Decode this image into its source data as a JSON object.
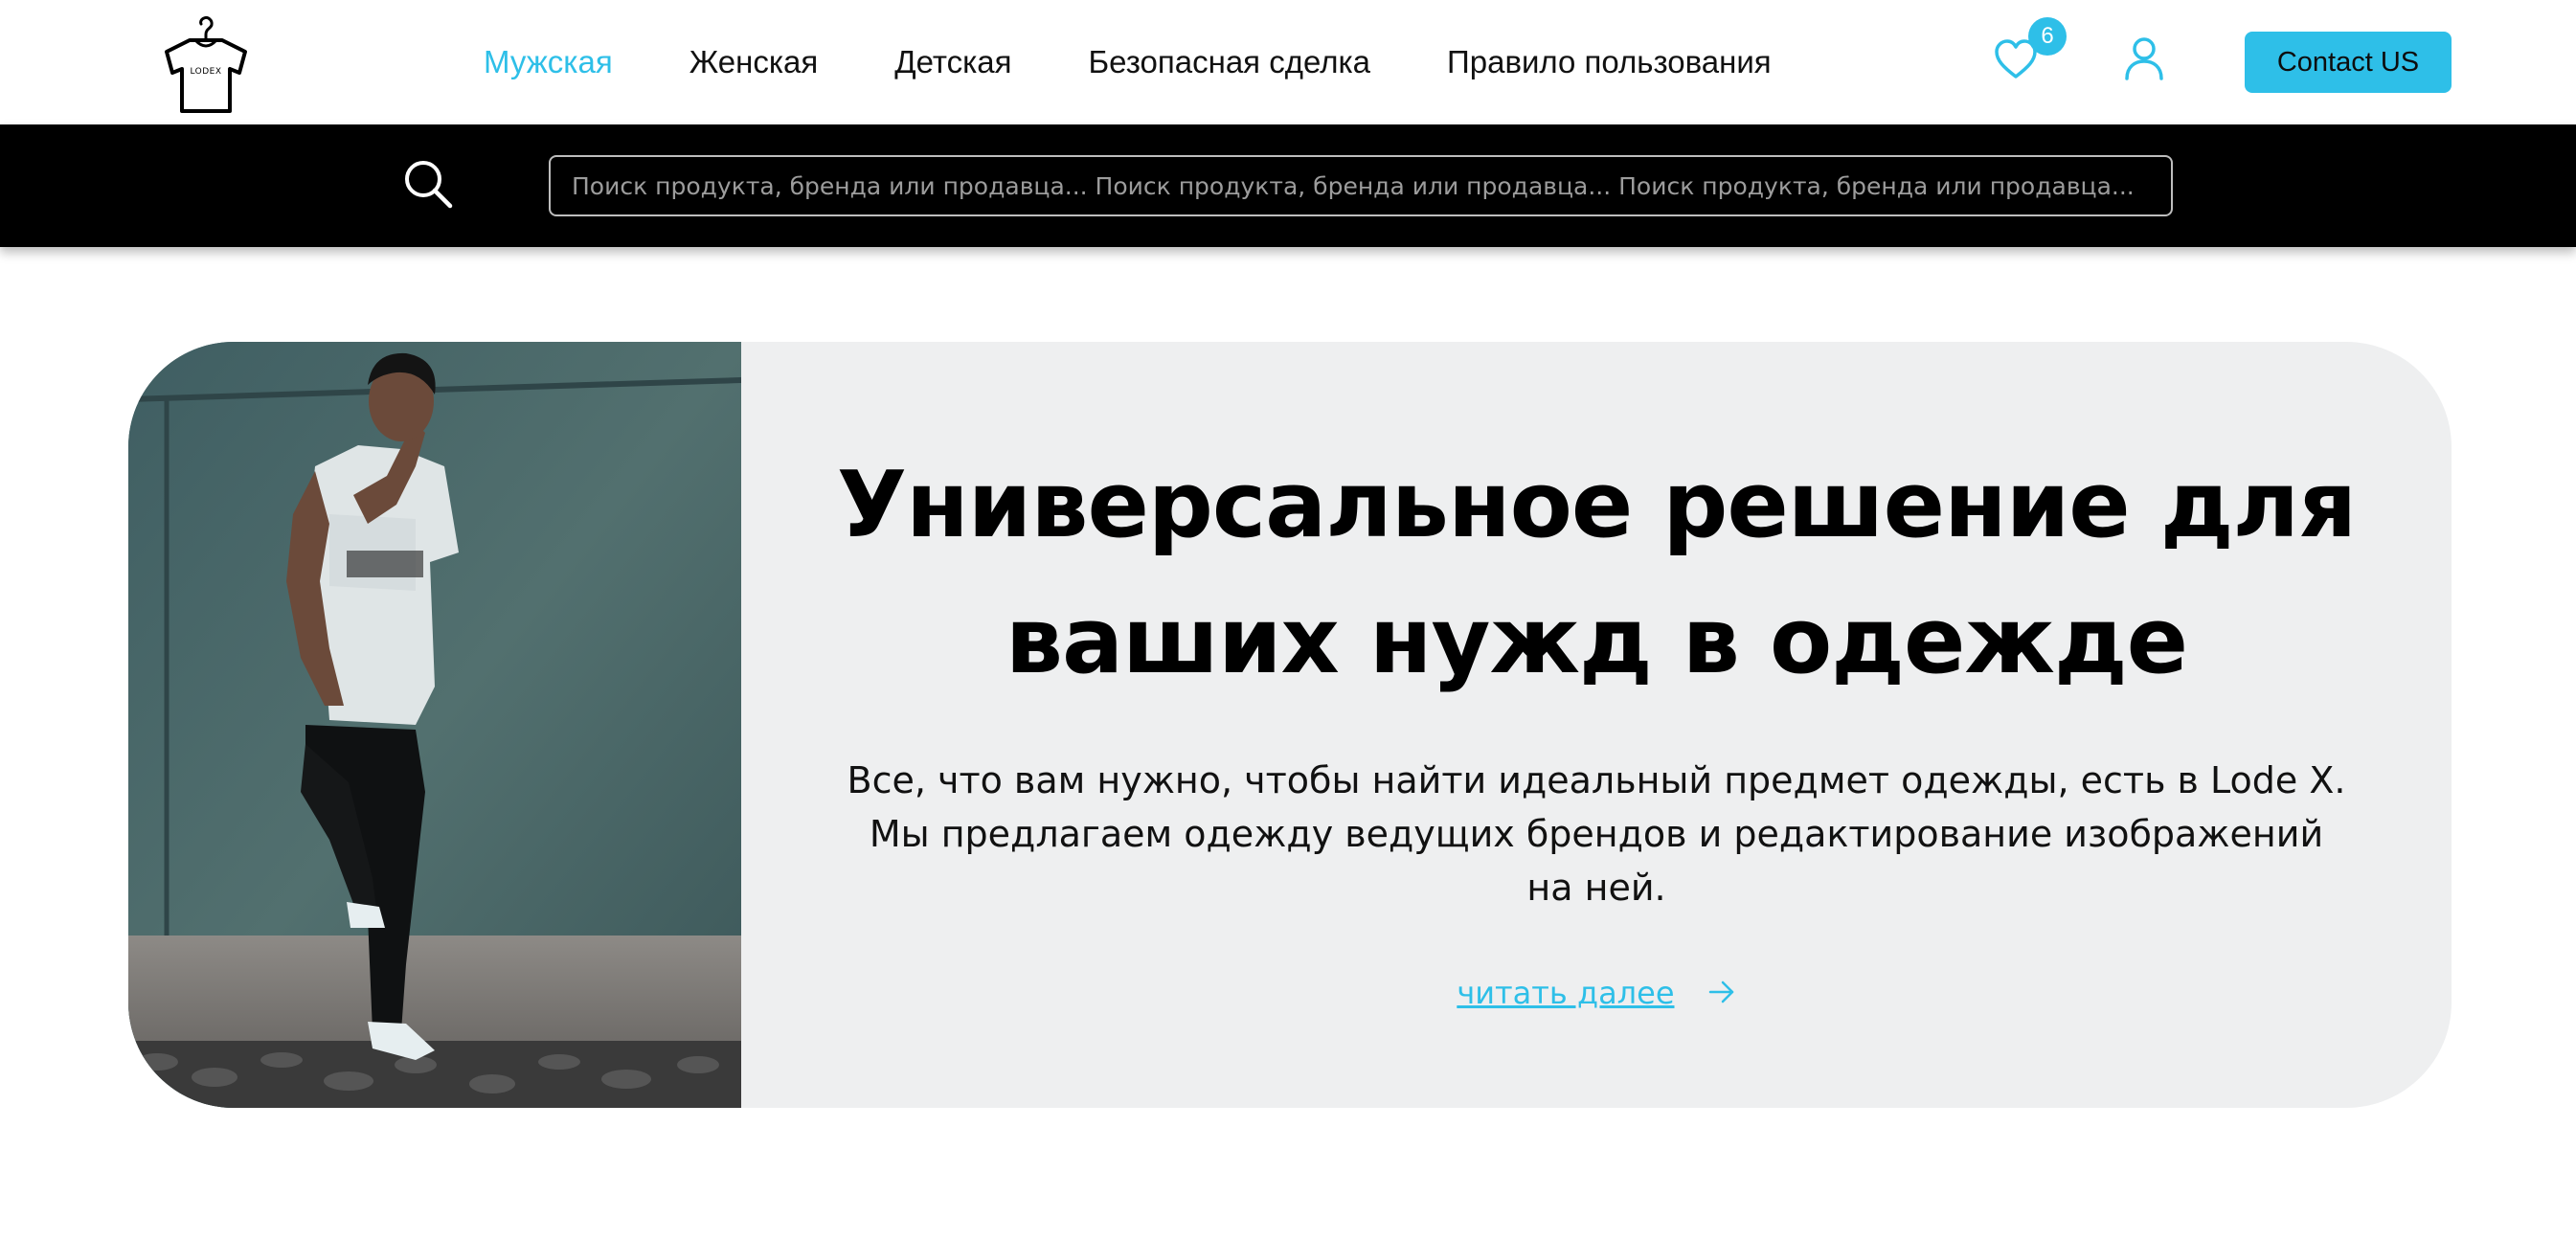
{
  "header": {
    "logo_text": "LODEX",
    "nav": [
      {
        "label": "Мужская",
        "active": true
      },
      {
        "label": "Женская",
        "active": false
      },
      {
        "label": "Детская",
        "active": false
      },
      {
        "label": "Безопасная сделка",
        "active": false
      },
      {
        "label": "Правило пользования",
        "active": false
      }
    ],
    "favorites_count": "6",
    "contact_label": "Contact US",
    "icons": {
      "favorites": "heart-icon",
      "account": "user-icon"
    }
  },
  "search": {
    "placeholder": "Поиск продукта, бренда или продавца... Поиск продукта, бренда или продавца... Поиск продукта, бренда или продавца...",
    "icon": "search-icon"
  },
  "hero": {
    "title_line1": "Универсальное решение для",
    "title_line2": "ваших нужд в одежде",
    "text_line1": "Все, что вам нужно, чтобы найти идеальный предмет одежды, есть в Lode X.",
    "text_line2": "Мы предлагаем одежду ведущих брендов и редактирование изображений",
    "text_line3": "на ней.",
    "read_more": "читать далее"
  },
  "colors": {
    "accent": "#2ebfe8",
    "searchbar_bg": "#000000",
    "hero_bg": "#eeeff0"
  }
}
